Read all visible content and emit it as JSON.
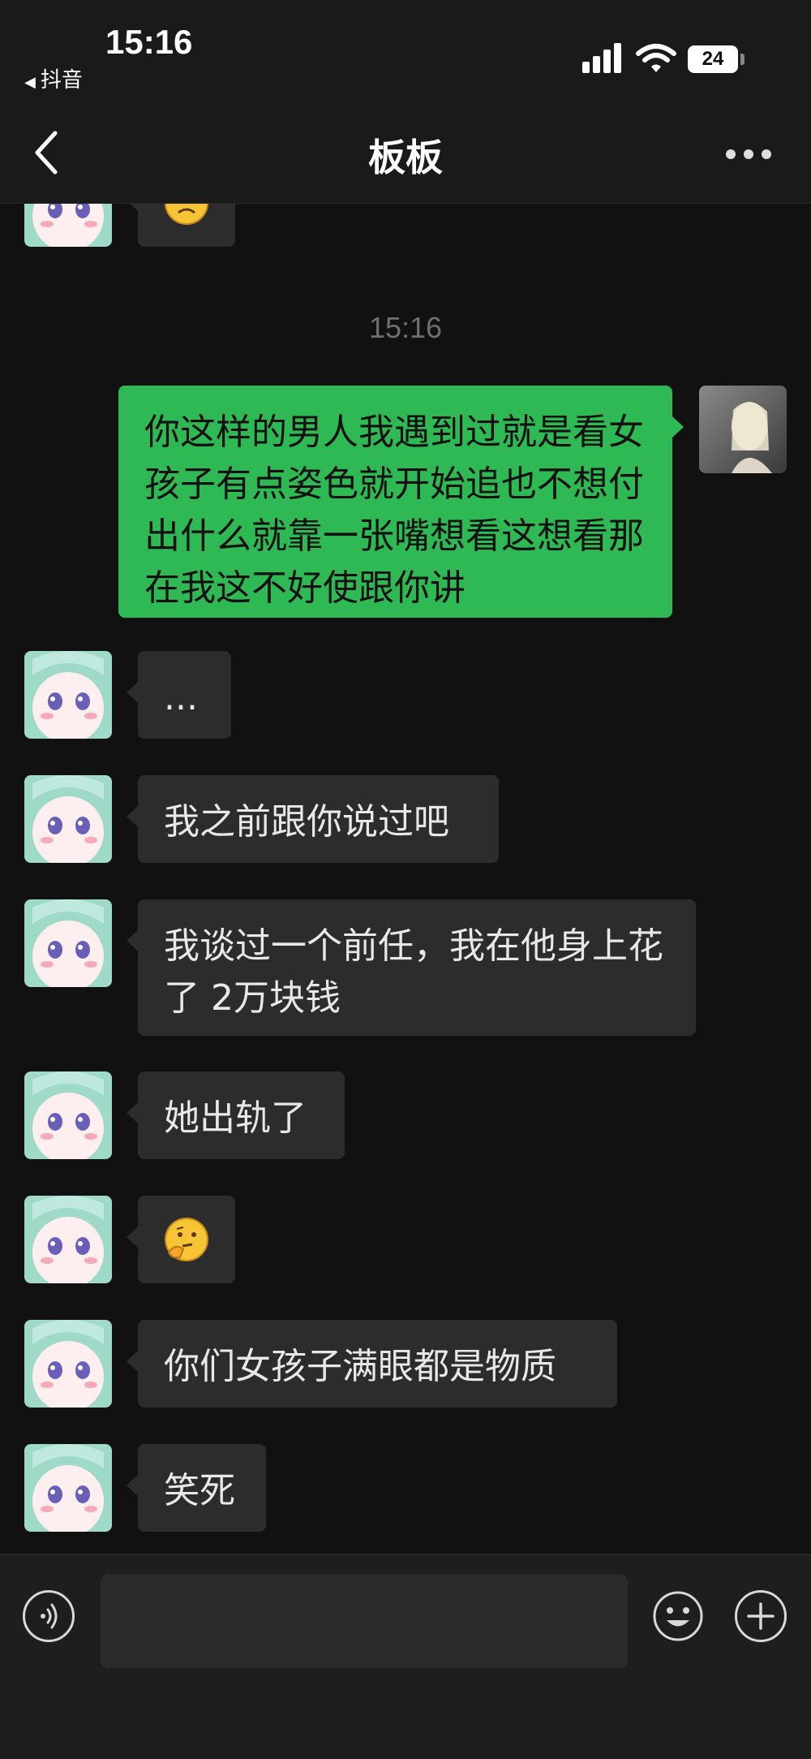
{
  "status_bar": {
    "time": "15:16",
    "back_app": "抖音",
    "battery": "24"
  },
  "header": {
    "title": "板板"
  },
  "messages": [
    {
      "sender": "contact",
      "type": "emoji",
      "emoji": "frown-face"
    },
    {
      "type": "timestamp",
      "text": "15:16"
    },
    {
      "sender": "me",
      "type": "text",
      "text": "你这样的男人我遇到过就是看女孩子有点姿色就开始追也不想付出什么就靠一张嘴想看这想看那在我这不好使跟你讲"
    },
    {
      "sender": "contact",
      "type": "text",
      "text": "..."
    },
    {
      "sender": "contact",
      "type": "text",
      "text": "我之前跟你说过吧"
    },
    {
      "sender": "contact",
      "type": "text",
      "text": "我谈过一个前任，我在他身上花了 2万块钱"
    },
    {
      "sender": "contact",
      "type": "text",
      "text": "她出轨了"
    },
    {
      "sender": "contact",
      "type": "emoji",
      "emoji": "thinking-face"
    },
    {
      "sender": "contact",
      "type": "text",
      "text": "你们女孩子满眼都是物质"
    },
    {
      "sender": "contact",
      "type": "text",
      "text": "笑死"
    }
  ],
  "input": {
    "placeholder": "",
    "value": ""
  },
  "colors": {
    "background": "#111111",
    "incoming_bubble": "#2c2c2c",
    "outgoing_bubble": "#2fb955",
    "timestamp": "#6f6f6f"
  },
  "icons": [
    "back-chevron-icon",
    "more-icon",
    "voice-icon",
    "emoji-icon",
    "plus-icon",
    "signal-icon",
    "wifi-icon",
    "battery-icon"
  ]
}
